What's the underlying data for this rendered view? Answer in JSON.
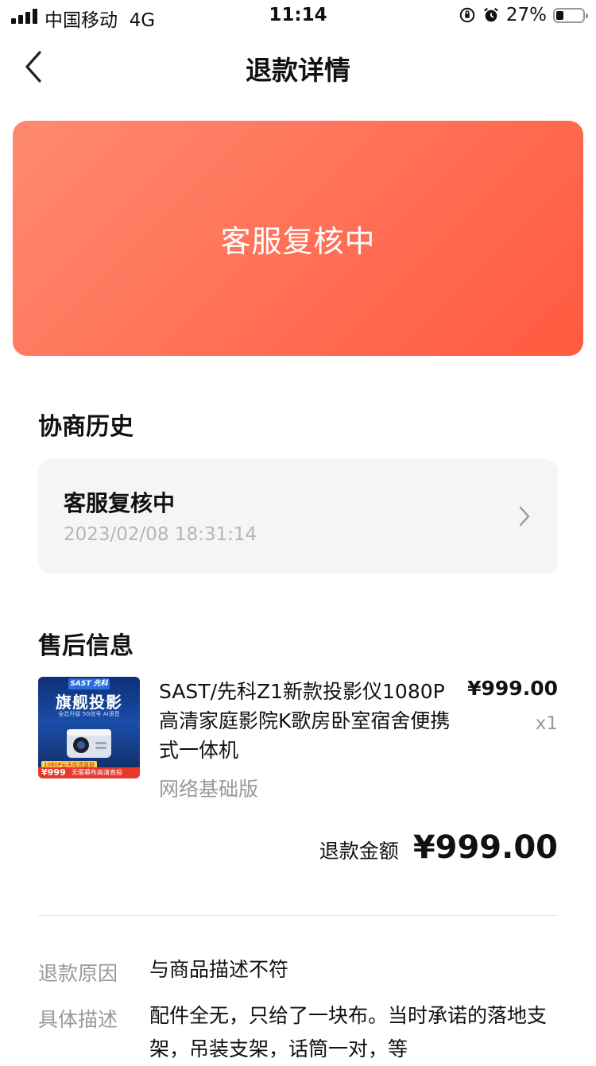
{
  "status_bar": {
    "carrier": "中国移动",
    "network": "4G",
    "time": "11:14",
    "battery": "27%",
    "battery_level": 0.27
  },
  "nav": {
    "title": "退款详情",
    "back_icon": "chevron-left-icon"
  },
  "status_card": {
    "text": "客服复核中",
    "colors": [
      "#ff8a6f",
      "#ff5a3f"
    ]
  },
  "history": {
    "section_title": "协商历史",
    "item": {
      "status": "客服复核中",
      "time": "2023/02/08 18:31:14"
    },
    "chevron_icon": "chevron-right-icon"
  },
  "after_sale": {
    "section_title": "售后信息",
    "product": {
      "name": "SAST/先科Z1新款投影仪1080P高清家庭影院K歌房卧室宿舍便携式一体机",
      "spec": "网络基础版",
      "price": "¥999.00",
      "qty": "x1",
      "image": {
        "brand": "SAST 先科",
        "headline": "旗舰投影",
        "sub": "全芯升级 5G信号 AI语音",
        "tag": "1080P云天际清直投",
        "price": "¥999",
        "slogan": "无需幕布高清直投"
      }
    },
    "refund_label": "退款金额",
    "refund_amount": "¥999.00"
  },
  "reason": {
    "label": "退款原因",
    "value": "与商品描述不符"
  },
  "description": {
    "label": "具体描述",
    "value": "配件全无，只给了一块布。当时承诺的落地支架，吊装支架，话筒一对，等"
  }
}
